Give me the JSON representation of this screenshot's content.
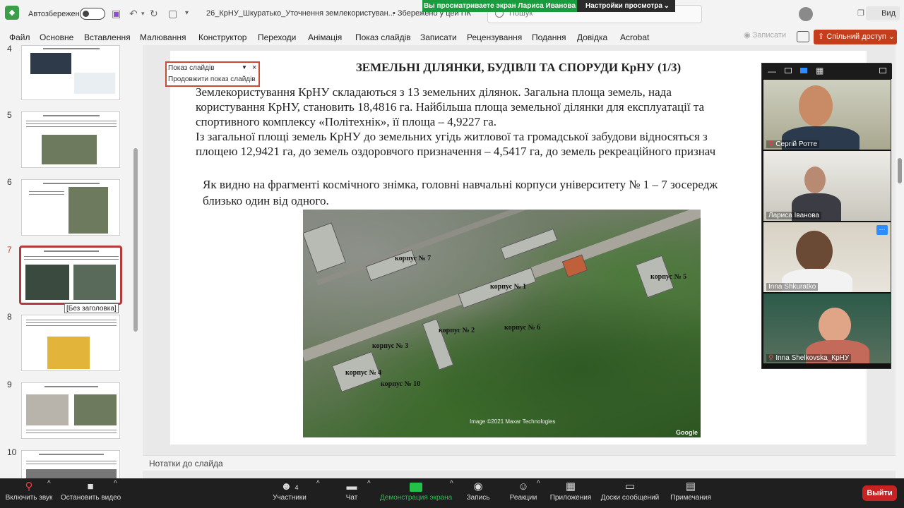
{
  "titlebar": {
    "autosave_label": "Автозбереження",
    "doc_title": "26_КрНУ_Шкуратько_Уточнення землекористуван...",
    "saved_state": "• Збережено у цей ПК",
    "search_placeholder": "Пошук",
    "view_label": "Вид"
  },
  "share_banner": {
    "viewing_text": "Вы просматриваете экран Лариса Иванова",
    "view_options_label": "Настройки просмотра"
  },
  "ribbon": {
    "tabs": [
      "Файл",
      "Основне",
      "Вставлення",
      "Малювання",
      "Конструктор",
      "Переходи",
      "Анімація",
      "Показ слайдів",
      "Записати",
      "Рецензування",
      "Подання",
      "Довідка",
      "Acrobat"
    ],
    "record_label": "Записати",
    "share_label": "Спільний доступ"
  },
  "thumbnails": {
    "numbers": [
      "4",
      "5",
      "6",
      "7",
      "8",
      "9",
      "10"
    ],
    "active_tooltip": "[Без заголовка]"
  },
  "slideshow_popup": {
    "title": "Показ слайдів",
    "resume_label": "Продовжити показ слайдів"
  },
  "slide": {
    "title": "ЗЕМЕЛЬНІ ДІЛЯНКИ, БУДІВЛІ ТА СПОРУДИ КрНУ (1/3)",
    "body_lines": [
      "Землекористування КрНУ складаються з 13 земельних ділянок. Загальна площа земель, нада",
      "користування КрНУ, становить 18,4816 га. Найбільша площа земельної ділянки для експлуатації та",
      "спортивного комплексу «Політехнік», її площа – 4,9227 га.",
      "Із загальної площі земель КрНУ до земельних угідь житлової та громадської забудови відносяться з",
      "площею 12,9421 га, до земель оздоровчого призначення – 4,5417 га, до земель рекреаційного признач"
    ],
    "sub_lines": [
      "Як видно на фрагменті космічного знімка, головні навчальні корпуси університету № 1 – 7 зосередж",
      "близько один від одного."
    ],
    "map_labels": [
      "корпус № 7",
      "корпус № 1",
      "корпус № 5",
      "корпус № 6",
      "корпус № 2",
      "корпус № 3",
      "корпус № 4",
      "корпус № 10"
    ],
    "map_credit": "Image ©2021 Maxar Technologies",
    "map_brand": "Google"
  },
  "notes_label": "Нотатки до слайда",
  "gallery": {
    "participants": [
      "Сергій Ротте",
      "Лариса Іванова",
      "Inna Shkuratko",
      "Inna Shelkovska_КрНУ"
    ]
  },
  "zoom_toolbar": {
    "mute_label": "Включить звук",
    "video_label": "Остановить видео",
    "participants_label": "Участники",
    "participants_count": "4",
    "chat_label": "Чат",
    "share_screen_label": "Демонстрация экрана",
    "record_label": "Запись",
    "reactions_label": "Реакции",
    "apps_label": "Приложения",
    "whiteboard_label": "Доски сообщений",
    "notes_label": "Примечания",
    "leave_label": "Выйти"
  },
  "colors": {
    "share_button": "#c43e1c",
    "active_thumb": "#b33a3a",
    "banner_green": "#1a9c3e",
    "zoom_green": "#23c04a",
    "leave_red": "#c82323"
  }
}
